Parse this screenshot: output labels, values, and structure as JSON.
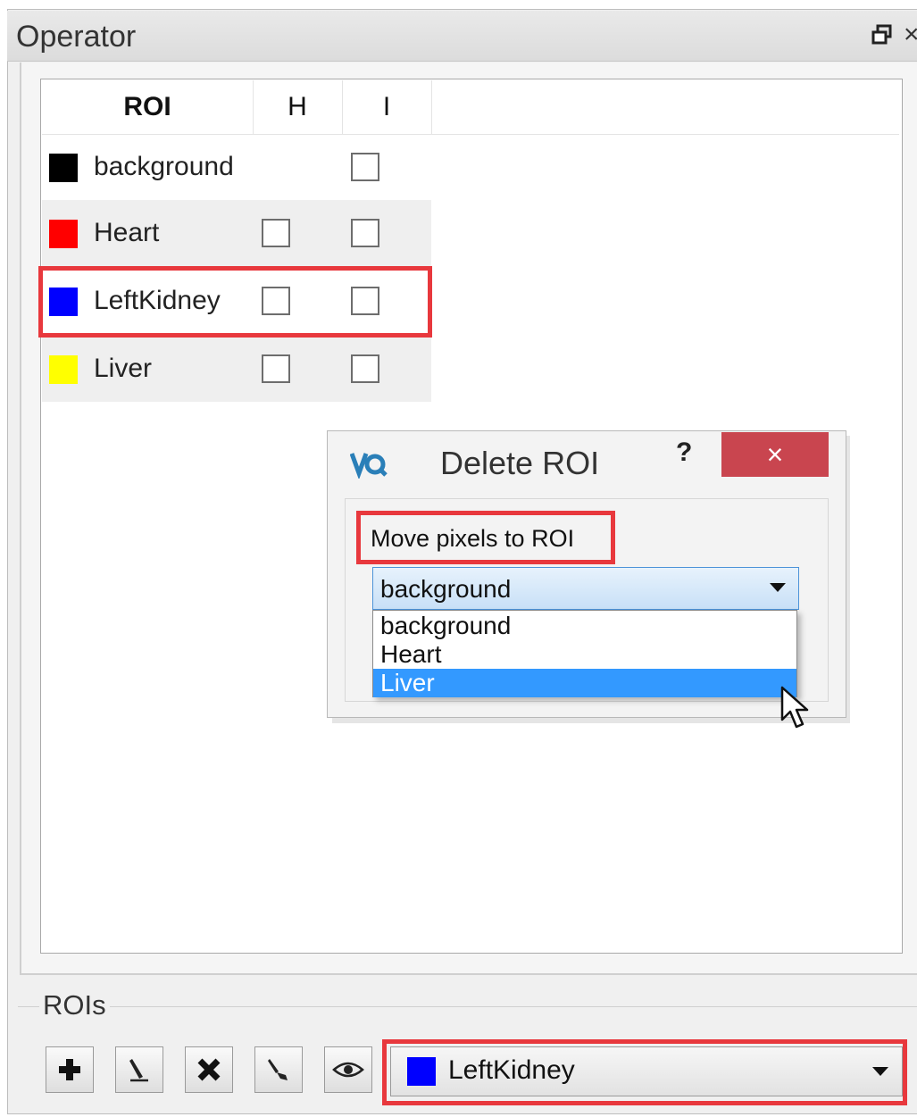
{
  "panel": {
    "title": "Operator"
  },
  "table": {
    "headers": {
      "roi": "ROI",
      "h": "H",
      "i": "I"
    },
    "rows": [
      {
        "label": "background",
        "color": "#000000",
        "has_h": false
      },
      {
        "label": "Heart",
        "color": "#ff0000",
        "has_h": true
      },
      {
        "label": "LeftKidney",
        "color": "#0000ff",
        "has_h": true,
        "highlighted": true
      },
      {
        "label": "Liver",
        "color": "#ffff00",
        "has_h": true
      }
    ]
  },
  "dialog": {
    "title": "Delete ROI",
    "help": "?",
    "close": "×",
    "prompt": "Move pixels to ROI",
    "selected": "background",
    "options": [
      "background",
      "Heart",
      "Liver"
    ],
    "hovered_option": "Liver"
  },
  "rois": {
    "group_label": "ROIs",
    "buttons": [
      "add-icon",
      "pencil-icon",
      "delete-icon",
      "brush-icon",
      "eye-icon"
    ],
    "current": "LeftKidney",
    "current_color": "#0000ff"
  },
  "accent_colors": {
    "highlight": "#e8383d",
    "selection": "#3399ff",
    "dialog_close": "#c9454f"
  }
}
